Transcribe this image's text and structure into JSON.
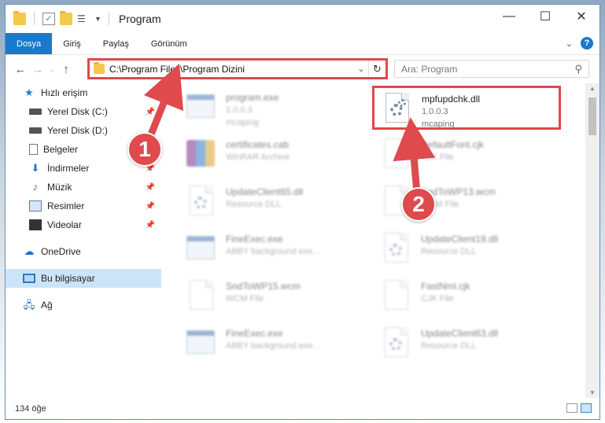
{
  "window": {
    "title": "Program"
  },
  "ribbon": {
    "tabs": [
      "Dosya",
      "Giriş",
      "Paylaş",
      "Görünüm"
    ]
  },
  "address": {
    "path": "C:\\Program Files\\Program Dizini"
  },
  "search": {
    "placeholder": "Ara: Program"
  },
  "sidebar": {
    "items": [
      {
        "label": "Hızlı erişim",
        "icon": "star-icon"
      },
      {
        "label": "Yerel Disk (C:)",
        "icon": "drive-icon"
      },
      {
        "label": "Yerel Disk (D:)",
        "icon": "drive-icon"
      },
      {
        "label": "Belgeler",
        "icon": "document-icon"
      },
      {
        "label": "İndirmeler",
        "icon": "download-icon"
      },
      {
        "label": "Müzik",
        "icon": "music-icon"
      },
      {
        "label": "Resimler",
        "icon": "pictures-icon"
      },
      {
        "label": "Videolar",
        "icon": "video-icon"
      },
      {
        "label": "OneDrive",
        "icon": "cloud-icon"
      },
      {
        "label": "Bu bilgisayar",
        "icon": "computer-icon"
      },
      {
        "label": "Ağ",
        "icon": "network-icon"
      }
    ]
  },
  "files": [
    {
      "name": "program.exe",
      "line1": "1.0.0.3",
      "line2": "mcaping"
    },
    {
      "name": "mpfupdchk.dll",
      "line1": "1.0.0.3",
      "line2": "mcaping"
    },
    {
      "name": "certificates.cab",
      "line1": "WinRAR Archive",
      "line2": ""
    },
    {
      "name": "DefaultFont.cjk",
      "line1": "CJK File",
      "line2": ""
    },
    {
      "name": "UpdateClient65.dll",
      "line1": "Resource DLL",
      "line2": ""
    },
    {
      "name": "SndToWP13.wcm",
      "line1": "WCM File",
      "line2": ""
    },
    {
      "name": "FineExec.exe",
      "line1": "ABBY background exe...",
      "line2": ""
    },
    {
      "name": "UpdateClient19.dll",
      "line1": "Resource DLL",
      "line2": ""
    },
    {
      "name": "SndToWP15.wcm",
      "line1": "WCM File",
      "line2": ""
    },
    {
      "name": "FastNml.cjk",
      "line1": "CJK File",
      "line2": ""
    },
    {
      "name": "FineExec.exe",
      "line1": "ABBY background exe...",
      "line2": ""
    },
    {
      "name": "UpdateClient63.dll",
      "line1": "Resource DLL",
      "line2": ""
    }
  ],
  "status": {
    "count": "134 öğe"
  },
  "annotations": {
    "step1": "1",
    "step2": "2"
  },
  "colors": {
    "accent": "#1979ca",
    "highlight": "#e0484b"
  }
}
